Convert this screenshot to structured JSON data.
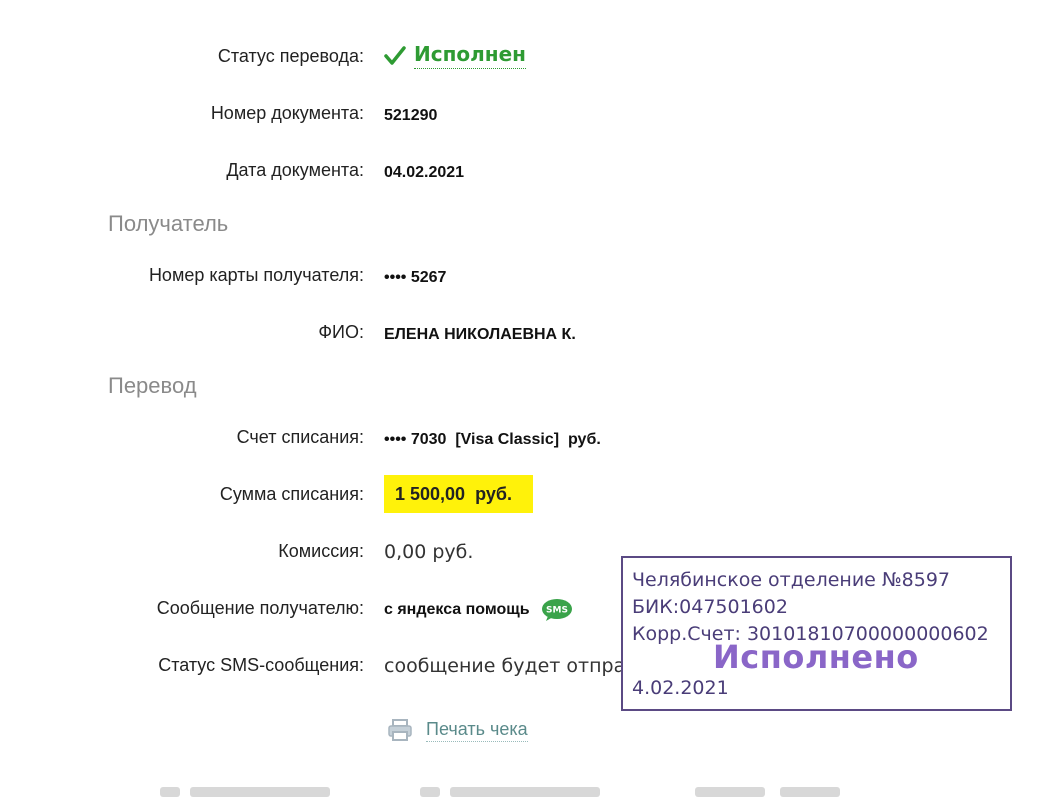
{
  "status": {
    "label": "Статус перевода:",
    "value": "Исполнен",
    "color": "#2e9b33"
  },
  "document": {
    "number_label": "Номер документа:",
    "number": "521290",
    "date_label": "Дата документа:",
    "date": "04.02.2021"
  },
  "recipient": {
    "section": "Получатель",
    "card_label": "Номер карты получателя:",
    "card": "•••• 5267",
    "name_label": "ФИО:",
    "name": "ЕЛЕНА НИКОЛАЕВНА К."
  },
  "transfer": {
    "section": "Перевод",
    "account_label": "Счет списания:",
    "account": "•••• 7030  [Visa Classic]  руб.",
    "amount_label": "Сумма списания:",
    "amount": "1 500,00  руб.",
    "amount_highlight": "#fff20a",
    "fee_label": "Комиссия:",
    "fee": "0,00 руб.",
    "message_label": "Сообщение получателю:",
    "message": "с яндекса помощь",
    "message_icon": "sms-icon",
    "sms_status_label": "Статус SMS-сообщения:",
    "sms_status": "сообщение будет отправлено"
  },
  "print": {
    "label": "Печать чека",
    "icon": "printer-icon"
  },
  "stamp": {
    "line1": "Челябинское отделение №8597",
    "line2": "БИК:047501602",
    "line3": "Корр.Счет: 30101810700000000602",
    "line4": "4.02.2021",
    "done": "Исполнено",
    "border_color": "#5b4a84"
  }
}
